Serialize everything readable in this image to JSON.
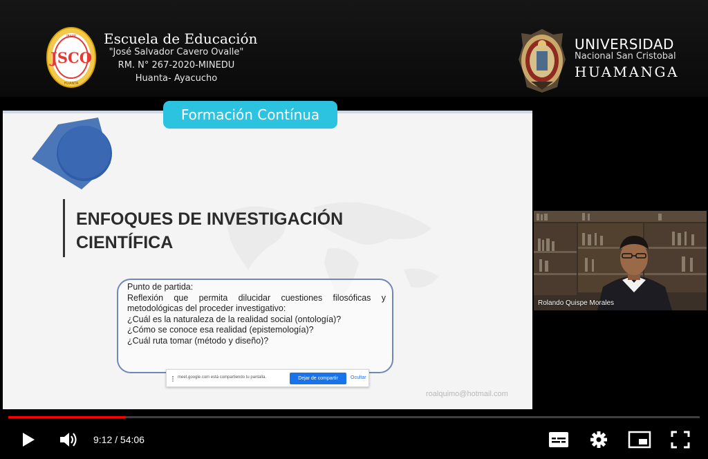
{
  "header": {
    "school": {
      "name": "Escuela de Educación",
      "line1": "\"José Salvador Cavero Ovalle\"",
      "line2": "RM. N° 267-2020-MINEDU",
      "line3": "Huanta- Ayacucho",
      "logo_text": "JSCO",
      "logo_top": "IESPP",
      "logo_bottom": "HUANTA"
    },
    "university": {
      "title": "UNIVERSIDAD",
      "subtitle": "Nacional San Cristobal",
      "city": "HUAMANGA"
    }
  },
  "banner": "Formación Contínua",
  "slide": {
    "title_line1": "ENFOQUES DE INVESTIGACIÓN",
    "title_line2": "CIENTÍFICA",
    "box_lines": [
      "Punto de partida:",
      "Reflexión que permita dilucidar cuestiones filosóficas y",
      "metodológicas del proceder investigativo:",
      "¿Cuál es la naturaleza de la realidad social  (ontología)?",
      "¿Cómo se conoce esa realidad (epistemología)?",
      "¿Cuál ruta tomar (método y diseño)?"
    ],
    "email": "roalquimo@hotmail.com"
  },
  "share_bar": {
    "text": "meet.google.com está compartiendo tu pantalla.",
    "stop_label": "Dejar de compartir",
    "hide_label": "Ocultar"
  },
  "camera": {
    "participant_name": "Rolando Quispe Morales"
  },
  "player": {
    "current_time": "9:12",
    "duration": "54:06",
    "time_display": "9:12 / 54:06",
    "progress_fraction": 0.17,
    "progress_color": "#ff0000",
    "icons": [
      "play-icon",
      "volume-icon",
      "subtitles-icon",
      "settings-icon",
      "miniplayer-icon",
      "fullscreen-icon"
    ]
  },
  "colors": {
    "banner": "#2cc3e0",
    "slide_bg": "#f4f4f4",
    "box_border": "#6f86b8"
  }
}
